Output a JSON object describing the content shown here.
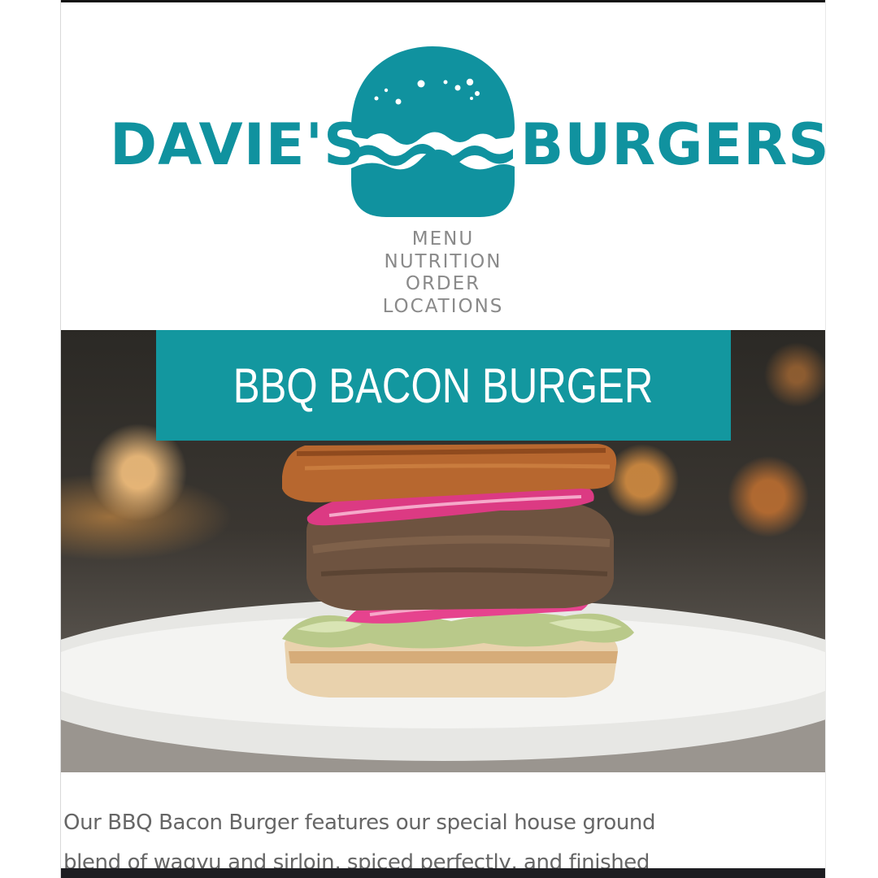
{
  "brand": {
    "left_word": "DAVIE'S",
    "right_word": "BURGERS",
    "color": "#10929f",
    "logo_icon": "burger-icon"
  },
  "nav": {
    "items": [
      {
        "label": "MENU"
      },
      {
        "label": "NUTRITION"
      },
      {
        "label": "ORDER"
      },
      {
        "label": "LOCATIONS"
      }
    ],
    "color": "#8a8a8a"
  },
  "hero": {
    "title": "BBQ BACON BURGER",
    "banner_color": "#13979f",
    "image": "burger-photo"
  },
  "description": {
    "line1": "Our BBQ Bacon Burger features our special house ground",
    "line2": "blend of wagyu and sirloin, spiced perfectly, and finished"
  }
}
